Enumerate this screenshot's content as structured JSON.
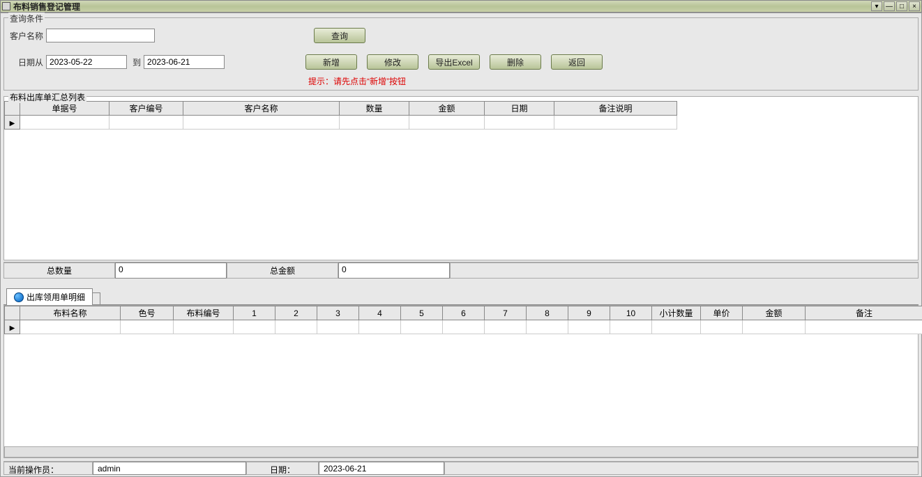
{
  "window": {
    "title": "布料销售登记管理"
  },
  "search": {
    "legend": "查询条件",
    "customer_label": "客户名称",
    "customer_value": "",
    "date_from_label": "日期从",
    "date_from_value": "2023-05-22",
    "date_to_label": "到",
    "date_to_value": "2023-06-21",
    "query_btn": "查询"
  },
  "toolbar": {
    "add": "新增",
    "edit": "修改",
    "export": "导出Excel",
    "delete": "删除",
    "back": "返回",
    "hint": "提示：请先点击“新增”按钮"
  },
  "summary_grid": {
    "legend": "布料出库单汇总列表",
    "headers": {
      "doc_no": "单据号",
      "cust_no": "客户编号",
      "cust_name": "客户名称",
      "qty": "数量",
      "amount": "金额",
      "date": "日期",
      "remark": "备注说明"
    },
    "totals": {
      "qty_label": "总数量",
      "qty_value": "0",
      "amount_label": "总金额",
      "amount_value": "0"
    }
  },
  "detail_tab": {
    "label": "出库领用单明细"
  },
  "detail_grid": {
    "headers": {
      "fabric_name": "布料名称",
      "color_no": "色号",
      "fabric_no": "布料编号",
      "c1": "1",
      "c2": "2",
      "c3": "3",
      "c4": "4",
      "c5": "5",
      "c6": "6",
      "c7": "7",
      "c8": "8",
      "c9": "9",
      "c10": "10",
      "subtotal": "小计数量",
      "price": "单价",
      "amount": "金额",
      "remark": "备注"
    }
  },
  "status": {
    "operator_label": "当前操作员：",
    "operator_value": "admin",
    "date_label": "日期：",
    "date_value": "2023-06-21"
  }
}
